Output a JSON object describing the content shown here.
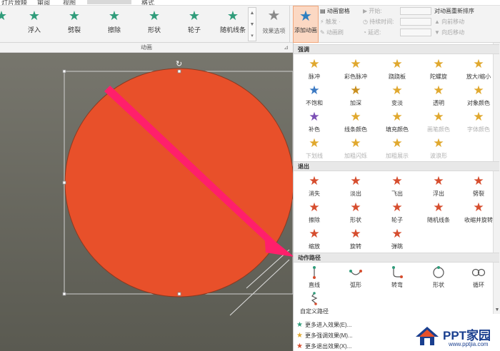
{
  "menubar": {
    "items": [
      "灯片放映",
      "审阅",
      "视图",
      "格式"
    ]
  },
  "ribbon": {
    "gallery": [
      {
        "label": "",
        "icon": "star-icon"
      },
      {
        "label": "浮入",
        "icon": "star-icon"
      },
      {
        "label": "劈裂",
        "icon": "star-icon"
      },
      {
        "label": "擦除",
        "icon": "star-icon"
      },
      {
        "label": "形状",
        "icon": "star-icon"
      },
      {
        "label": "轮子",
        "icon": "star-icon"
      },
      {
        "label": "随机线条",
        "icon": "star-icon"
      }
    ],
    "group_label": "动画",
    "effect_options": "效果选项",
    "add_animation": "添加动画",
    "advanced": {
      "pane": "动画窗格",
      "trigger": "触发 ·",
      "painter": "动画刷"
    },
    "timing": {
      "start": "开始:",
      "duration": "持续时间:",
      "delay": "延迟:"
    },
    "reorder": {
      "title": "对动画重新排序",
      "earlier": "向前移动",
      "later": "向后移动"
    }
  },
  "panel": {
    "emphasis": {
      "header": "强调",
      "items": [
        {
          "label": "脉冲",
          "icon": "star-icon",
          "color": "gold",
          "disabled": false
        },
        {
          "label": "彩色脉冲",
          "icon": "star-burst-icon",
          "color": "gold",
          "disabled": false
        },
        {
          "label": "跷跷板",
          "icon": "star-icon",
          "color": "gold",
          "disabled": false
        },
        {
          "label": "陀螺旋",
          "icon": "star-spin-icon",
          "color": "gold",
          "disabled": false
        },
        {
          "label": "放大/缩小",
          "icon": "star-grow-icon",
          "color": "gold",
          "disabled": false
        },
        {
          "label": "不饱和",
          "icon": "star-icon",
          "color": "blue",
          "disabled": false
        },
        {
          "label": "加深",
          "icon": "star-icon",
          "color": "gold2",
          "disabled": false
        },
        {
          "label": "变淡",
          "icon": "star-icon",
          "color": "gold",
          "disabled": false
        },
        {
          "label": "透明",
          "icon": "star-icon",
          "color": "gold",
          "disabled": false
        },
        {
          "label": "对象颜色",
          "icon": "star-icon",
          "color": "gold",
          "disabled": false
        },
        {
          "label": "补色",
          "icon": "star-icon",
          "color": "purple",
          "disabled": false
        },
        {
          "label": "线条颜色",
          "icon": "star-icon",
          "color": "gold",
          "disabled": false
        },
        {
          "label": "填充颜色",
          "icon": "star-icon",
          "color": "gold",
          "disabled": false
        },
        {
          "label": "画笔颜色",
          "icon": "star-icon",
          "color": "gold",
          "disabled": true
        },
        {
          "label": "字体颜色",
          "icon": "star-icon",
          "color": "gold",
          "disabled": true
        },
        {
          "label": "下划线",
          "icon": "star-icon",
          "color": "gold",
          "disabled": true
        },
        {
          "label": "加粗闪烁",
          "icon": "star-icon",
          "color": "gold",
          "disabled": true
        },
        {
          "label": "加粗展示",
          "icon": "star-icon",
          "color": "gold",
          "disabled": true
        },
        {
          "label": "波浪形",
          "icon": "star-icon",
          "color": "gold",
          "disabled": true
        }
      ]
    },
    "exit": {
      "header": "退出",
      "items": [
        {
          "label": "消失",
          "icon": "star-icon"
        },
        {
          "label": "淡出",
          "icon": "star-icon"
        },
        {
          "label": "飞出",
          "icon": "star-icon"
        },
        {
          "label": "浮出",
          "icon": "star-icon"
        },
        {
          "label": "劈裂",
          "icon": "star-icon"
        },
        {
          "label": "擦除",
          "icon": "star-icon"
        },
        {
          "label": "形状",
          "icon": "star-icon"
        },
        {
          "label": "轮子",
          "icon": "star-icon"
        },
        {
          "label": "随机线条",
          "icon": "star-icon"
        },
        {
          "label": "收缩并旋转",
          "icon": "star-icon"
        },
        {
          "label": "缩放",
          "icon": "star-icon"
        },
        {
          "label": "旋转",
          "icon": "star-icon"
        },
        {
          "label": "弹跳",
          "icon": "star-icon"
        }
      ]
    },
    "paths": {
      "header": "动作路径",
      "items": [
        {
          "label": "直线",
          "icon": "line-path-icon"
        },
        {
          "label": "弧形",
          "icon": "arc-path-icon"
        },
        {
          "label": "转弯",
          "icon": "turn-path-icon"
        },
        {
          "label": "形状",
          "icon": "circle-path-icon"
        },
        {
          "label": "循环",
          "icon": "loop-path-icon"
        },
        {
          "label": "自定义路径",
          "icon": "custom-path-icon"
        }
      ]
    },
    "more": [
      {
        "label": "更多进入效果(E)...",
        "color": "#2f9c7a"
      },
      {
        "label": "更多强调效果(M)...",
        "color": "#e0a82e"
      },
      {
        "label": "更多退出效果(X)...",
        "color": "#d64d2e"
      }
    ]
  },
  "brand": {
    "name": "PPT家园",
    "url": "www.pptjia.com"
  },
  "colors": {
    "accent": "#e8502a",
    "arrow": "#ff1f6b",
    "entrance": "#2f9c7a",
    "emphasis": "#e0a82e",
    "exit": "#d64d2e",
    "ribbon_bg": "#f3f3f3",
    "highlight": "#fbd8c3"
  }
}
